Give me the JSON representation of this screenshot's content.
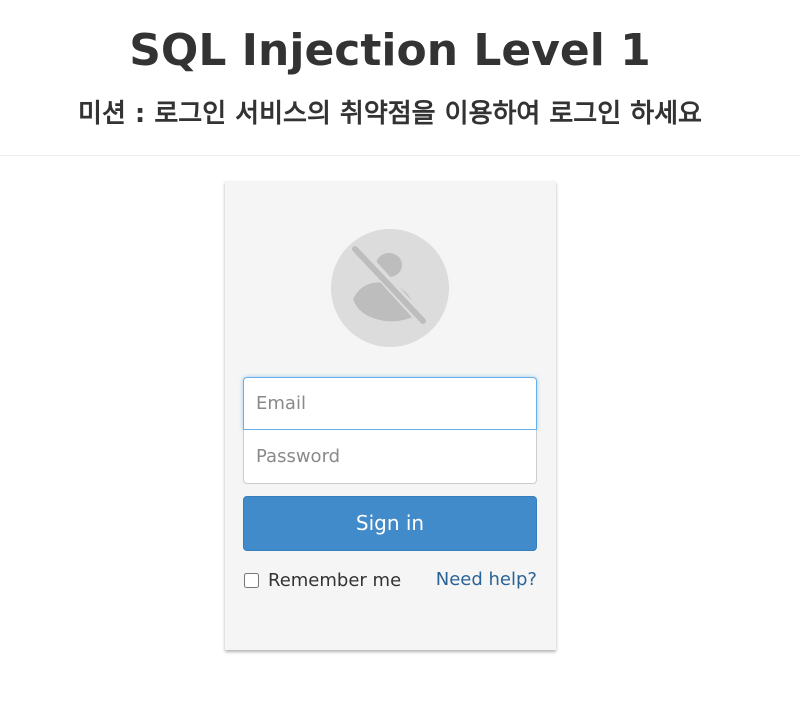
{
  "header": {
    "title": "SQL Injection Level 1",
    "mission": "미션 : 로그인 서비스의 취약점을 이용하여 로그인 하세요"
  },
  "login": {
    "avatar_icon": "user-slash-icon",
    "email_placeholder": "Email",
    "email_value": "",
    "password_placeholder": "Password",
    "password_value": "",
    "signin_label": "Sign in",
    "remember_label": "Remember me",
    "remember_checked": false,
    "help_label": "Need help?"
  },
  "colors": {
    "primary": "#428bca",
    "link": "#2a6496",
    "card_bg": "#f5f5f5",
    "focus_border": "#66afe9"
  }
}
